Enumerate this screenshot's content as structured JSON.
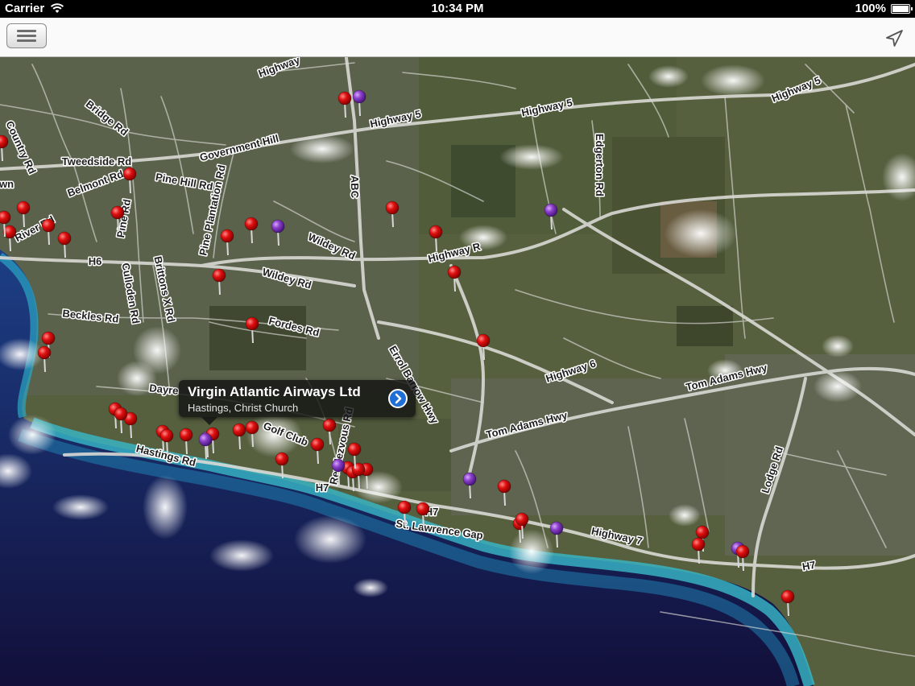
{
  "status_bar": {
    "carrier": "Carrier",
    "time": "10:34 PM",
    "battery": "100%",
    "battery_level": 1.0
  },
  "map": {
    "labels": [
      {
        "text": "Highway 5"
      },
      {
        "text": "Highway 5"
      },
      {
        "text": "Highway 5"
      },
      {
        "text": "Highway"
      },
      {
        "text": "Bridge Rd"
      },
      {
        "text": "Tweedside Rd"
      },
      {
        "text": "Government Hill"
      },
      {
        "text": "Country Rd"
      },
      {
        "text": "Belmont Rd"
      },
      {
        "text": "Pine Hill Rd"
      },
      {
        "text": "Pine Plantation Rd"
      },
      {
        "text": "River Rd"
      },
      {
        "text": "Pine Rd"
      },
      {
        "text": "H6"
      },
      {
        "text": "Culloden Rd"
      },
      {
        "text": "Brittons X Rd"
      },
      {
        "text": "Wildey Rd"
      },
      {
        "text": "Wildey Rd"
      },
      {
        "text": "Highway R"
      },
      {
        "text": "Beckles Rd"
      },
      {
        "text": "Fordes Rd"
      },
      {
        "text": "Edgerton Rd"
      },
      {
        "text": "ABC"
      },
      {
        "text": "Errol Barrow Hwy"
      },
      {
        "text": "Highway 6"
      },
      {
        "text": "Tom Adams Hwy"
      },
      {
        "text": "Tom Adams Hwy"
      },
      {
        "text": "Dayre"
      },
      {
        "text": "Golf Club"
      },
      {
        "text": "Rendezvous Rd"
      },
      {
        "text": "Hastings Rd"
      },
      {
        "text": "H7"
      },
      {
        "text": "St. Lawrence Gap"
      },
      {
        "text": "Highway 7"
      },
      {
        "text": "Lodge Rd"
      },
      {
        "text": "H7"
      },
      {
        "text": "H7"
      },
      {
        "text": "wn"
      }
    ],
    "pins": [
      {
        "color": "red"
      },
      {
        "color": "purple"
      },
      {
        "color": "red"
      },
      {
        "color": "red"
      },
      {
        "color": "red"
      },
      {
        "color": "red"
      },
      {
        "color": "red"
      },
      {
        "color": "red"
      },
      {
        "color": "red"
      },
      {
        "color": "red"
      },
      {
        "color": "purple"
      },
      {
        "color": "red"
      },
      {
        "color": "red"
      },
      {
        "color": "red"
      },
      {
        "color": "purple"
      },
      {
        "color": "red"
      },
      {
        "color": "red"
      },
      {
        "color": "red"
      },
      {
        "color": "red"
      },
      {
        "color": "red"
      },
      {
        "color": "red"
      },
      {
        "color": "red"
      },
      {
        "color": "purple"
      },
      {
        "color": "red"
      },
      {
        "color": "red"
      },
      {
        "color": "red"
      },
      {
        "color": "red"
      },
      {
        "color": "purple"
      },
      {
        "color": "red"
      },
      {
        "color": "red"
      },
      {
        "color": "red"
      },
      {
        "color": "red"
      },
      {
        "color": "red"
      },
      {
        "color": "red"
      },
      {
        "color": "purple"
      },
      {
        "color": "red"
      },
      {
        "color": "red"
      },
      {
        "color": "red"
      },
      {
        "color": "red"
      },
      {
        "color": "red"
      },
      {
        "color": "red"
      },
      {
        "color": "purple"
      },
      {
        "color": "red"
      },
      {
        "color": "red"
      },
      {
        "color": "purple"
      },
      {
        "color": "red"
      },
      {
        "color": "red"
      },
      {
        "color": "purple"
      },
      {
        "color": "red"
      },
      {
        "color": "red"
      },
      {
        "color": "red"
      },
      {
        "color": "red"
      },
      {
        "color": "red"
      },
      {
        "color": "red"
      }
    ]
  },
  "callout": {
    "title": "Virgin Atlantic Airways Ltd",
    "subtitle": "Hastings, Christ Church"
  },
  "icons": {
    "menu": "menu-icon",
    "locate": "location-arrow-icon",
    "disclosure": "disclosure-icon"
  },
  "colors": {
    "pin_red": "#e01010",
    "pin_purple": "#8a3fc8",
    "accent": "#1f6fd6"
  }
}
